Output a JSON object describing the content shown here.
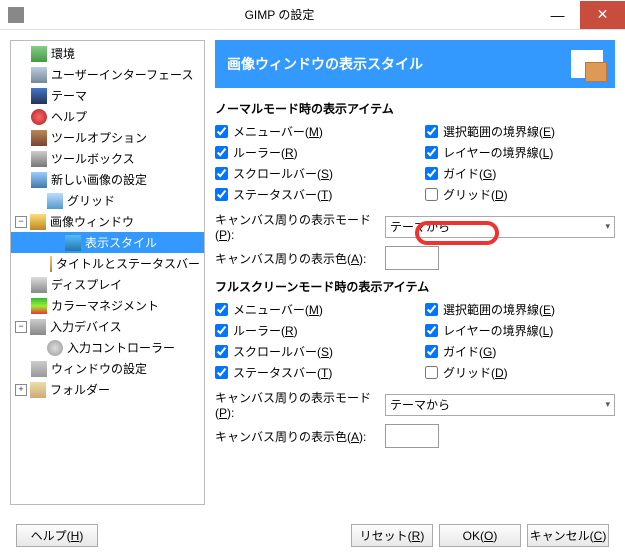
{
  "window": {
    "title": "GIMP の設定"
  },
  "sidebar": {
    "items": [
      {
        "label": "環境",
        "indent": 0,
        "expander": ""
      },
      {
        "label": "ユーザーインターフェース",
        "indent": 0,
        "expander": ""
      },
      {
        "label": "テーマ",
        "indent": 0,
        "expander": ""
      },
      {
        "label": "ヘルプ",
        "indent": 0,
        "expander": ""
      },
      {
        "label": "ツールオプション",
        "indent": 0,
        "expander": ""
      },
      {
        "label": "ツールボックス",
        "indent": 0,
        "expander": ""
      },
      {
        "label": "新しい画像の設定",
        "indent": 0,
        "expander": ""
      },
      {
        "label": "グリッド",
        "indent": 1,
        "expander": ""
      },
      {
        "label": "画像ウィンドウ",
        "indent": 0,
        "expander": "−"
      },
      {
        "label": "表示スタイル",
        "indent": 2,
        "expander": ""
      },
      {
        "label": "タイトルとステータスバー",
        "indent": 2,
        "expander": ""
      },
      {
        "label": "ディスプレイ",
        "indent": 0,
        "expander": ""
      },
      {
        "label": "カラーマネジメント",
        "indent": 0,
        "expander": ""
      },
      {
        "label": "入力デバイス",
        "indent": 0,
        "expander": "−"
      },
      {
        "label": "入力コントローラー",
        "indent": 1,
        "expander": ""
      },
      {
        "label": "ウィンドウの設定",
        "indent": 0,
        "expander": ""
      },
      {
        "label": "フォルダー",
        "indent": 0,
        "expander": "+"
      }
    ]
  },
  "header": {
    "title": "画像ウィンドウの表示スタイル"
  },
  "normal": {
    "title": "ノーマルモード時の表示アイテム",
    "items": [
      {
        "label": "メニューバー(",
        "key": "M",
        "checked": true
      },
      {
        "label": "選択範囲の境界線(",
        "key": "E",
        "checked": true
      },
      {
        "label": "ルーラー(",
        "key": "R",
        "checked": true
      },
      {
        "label": "レイヤーの境界線(",
        "key": "L",
        "checked": true
      },
      {
        "label": "スクロールバー(",
        "key": "S",
        "checked": true
      },
      {
        "label": "ガイド(",
        "key": "G",
        "checked": true
      },
      {
        "label": "ステータスバー(",
        "key": "T",
        "checked": true
      },
      {
        "label": "グリッド(",
        "key": "D",
        "checked": false
      }
    ],
    "mode_label": "キャンバス周りの表示モード(",
    "mode_key": "P",
    "mode_value": "テーマから",
    "color_label": "キャンバス周りの表示色(",
    "color_key": "A"
  },
  "full": {
    "title": "フルスクリーンモード時の表示アイテム",
    "items": [
      {
        "label": "メニューバー(",
        "key": "M",
        "checked": true
      },
      {
        "label": "選択範囲の境界線(",
        "key": "E",
        "checked": true
      },
      {
        "label": "ルーラー(",
        "key": "R",
        "checked": true
      },
      {
        "label": "レイヤーの境界線(",
        "key": "L",
        "checked": true
      },
      {
        "label": "スクロールバー(",
        "key": "S",
        "checked": true
      },
      {
        "label": "ガイド(",
        "key": "G",
        "checked": true
      },
      {
        "label": "ステータスバー(",
        "key": "T",
        "checked": true
      },
      {
        "label": "グリッド(",
        "key": "D",
        "checked": false
      }
    ],
    "mode_label": "キャンバス周りの表示モード(",
    "mode_key": "P",
    "mode_value": "テーマから",
    "color_label": "キャンバス周りの表示色(",
    "color_key": "A"
  },
  "footer": {
    "help": "ヘルプ(",
    "help_key": "H",
    "reset": "リセット(",
    "reset_key": "R",
    "ok": "OK(",
    "ok_key": "O",
    "cancel": "キャンセル(",
    "cancel_key": "C"
  }
}
